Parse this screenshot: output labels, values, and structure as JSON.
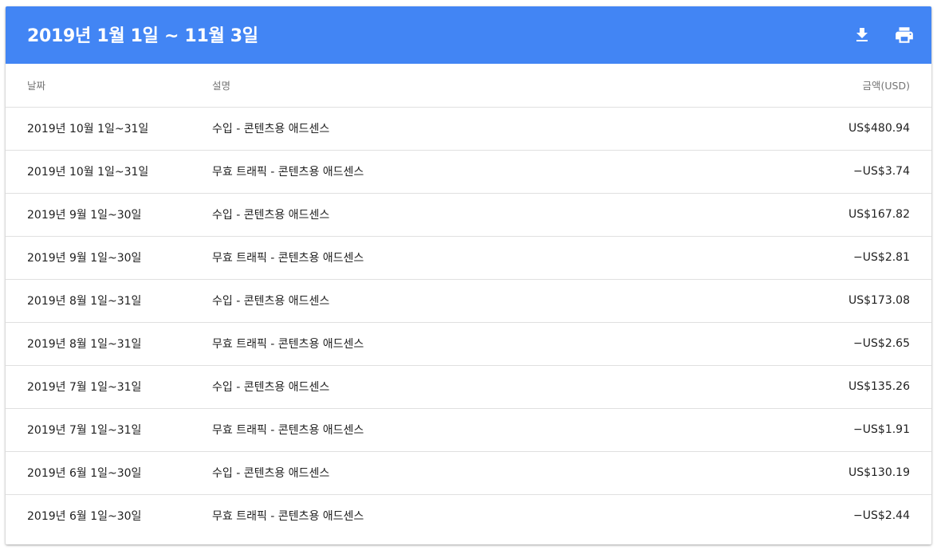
{
  "header": {
    "title": "2019년 1월 1일 ~ 11월 3일",
    "download_icon": "download-icon",
    "print_icon": "print-icon",
    "accent_color": "#4285f4"
  },
  "table": {
    "columns": {
      "date": "날짜",
      "description": "설명",
      "amount": "금액(USD)"
    },
    "rows": [
      {
        "date": "2019년 10월 1일~31일",
        "description": "수입 - 콘텐츠용 애드센스",
        "amount": "US$480.94"
      },
      {
        "date": "2019년 10월 1일~31일",
        "description": "무효 트래픽 - 콘텐츠용 애드센스",
        "amount": "−US$3.74"
      },
      {
        "date": "2019년 9월 1일~30일",
        "description": "수입 - 콘텐츠용 애드센스",
        "amount": "US$167.82"
      },
      {
        "date": "2019년 9월 1일~30일",
        "description": "무효 트래픽 - 콘텐츠용 애드센스",
        "amount": "−US$2.81"
      },
      {
        "date": "2019년 8월 1일~31일",
        "description": "수입 - 콘텐츠용 애드센스",
        "amount": "US$173.08"
      },
      {
        "date": "2019년 8월 1일~31일",
        "description": "무효 트래픽 - 콘텐츠용 애드센스",
        "amount": "−US$2.65"
      },
      {
        "date": "2019년 7월 1일~31일",
        "description": "수입 - 콘텐츠용 애드센스",
        "amount": "US$135.26"
      },
      {
        "date": "2019년 7월 1일~31일",
        "description": "무효 트래픽 - 콘텐츠용 애드센스",
        "amount": "−US$1.91"
      },
      {
        "date": "2019년 6월 1일~30일",
        "description": "수입 - 콘텐츠용 애드센스",
        "amount": "US$130.19"
      },
      {
        "date": "2019년 6월 1일~30일",
        "description": "무효 트래픽 - 콘텐츠용 애드센스",
        "amount": "−US$2.44"
      }
    ]
  }
}
